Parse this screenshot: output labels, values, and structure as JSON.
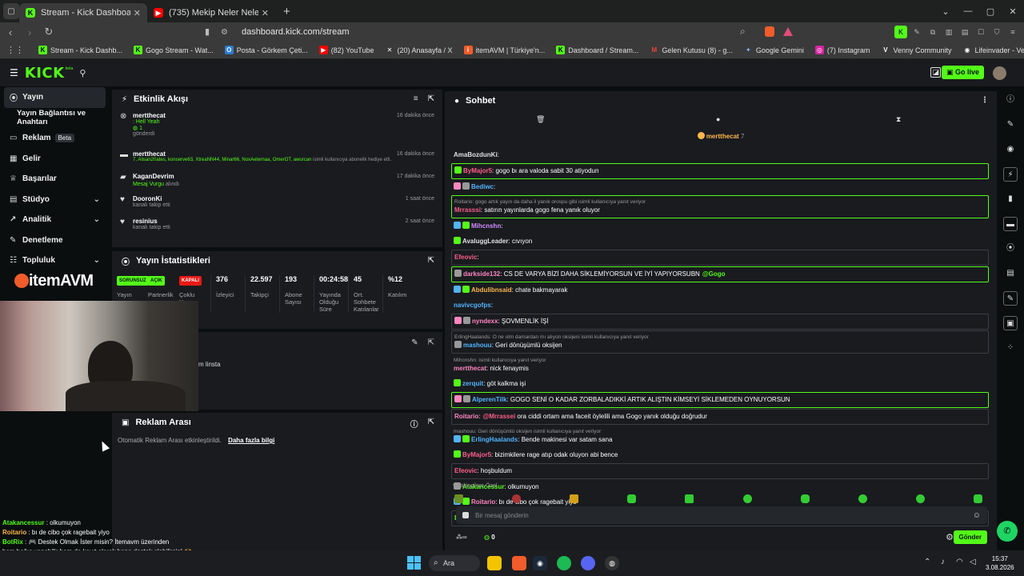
{
  "browser": {
    "tabs": [
      {
        "label": "Stream - Kick Dashboard",
        "active": true
      },
      {
        "label": "(735) Mekip Neler Neler 83.Bölüm İz"
      }
    ],
    "url": "dashboard.kick.com/stream",
    "bookmarks": [
      "Stream - Kick Dashb...",
      "Gogo Stream - Wat...",
      "Posta - Görkem Çeti...",
      "(82) YouTube",
      "(20) Anasayfa / X",
      "itemAVM | Türkiye'n...",
      "Dashboard / Stream...",
      "Gelen Kutusu (8) - g...",
      "Google Gemini",
      "(7) Instagram",
      "Venny Community",
      "Lifeinvader - VennyV"
    ]
  },
  "topnav": {
    "logo": "KICK",
    "logo_tag": "beta",
    "go_live": "Go live"
  },
  "sidebar": {
    "items": [
      {
        "label": "Yayın",
        "icon": "broadcast-icon",
        "active": true
      },
      {
        "label": "Yayın Bağlantısı ve Anahtarı"
      },
      {
        "label": "Reklam",
        "icon": "ad-icon",
        "badge": "Beta"
      },
      {
        "label": "Gelir",
        "icon": "money-icon"
      },
      {
        "label": "Başarılar",
        "icon": "trophy-icon"
      },
      {
        "label": "Stüdyo",
        "icon": "studio-icon",
        "expandable": true
      },
      {
        "label": "Analitik",
        "icon": "analytics-icon",
        "expandable": true
      },
      {
        "label": "Denetleme",
        "icon": "wrench-icon"
      },
      {
        "label": "Topluluk",
        "icon": "community-icon",
        "expandable": true
      }
    ]
  },
  "activity": {
    "title": "Etkinlik Akışı",
    "events": [
      {
        "user": "mertthecat",
        "detail": ": Hell Yeah",
        "amount": "1",
        "sub": "gönderdi",
        "time": "16 dakika önce"
      },
      {
        "user": "mertthecat",
        "detail": "7, Alisan20ates, konserve63, XtreaNN44, Minar66, NoxAeternaa, OmerOT, awurcan",
        "detail_suffix": " isimli kullanıcıya abonelik hediye etti.",
        "time": "16 dakika önce"
      },
      {
        "user": "KaganDevrim",
        "detail": "Mesaj Vurgu",
        "detail_suffix": " alındı",
        "time": "17 dakika önce"
      },
      {
        "user": "DooronKi",
        "sub": "kanalı takip etti",
        "time": "1 saat önce"
      },
      {
        "user": "resinius",
        "sub": "kanalı takip etti",
        "time": "2 saat önce"
      }
    ]
  },
  "stats": {
    "title": "Yayın İstatistikleri",
    "items": [
      {
        "value": "SORUNSUZ",
        "label": "Yayın",
        "pill": "#53fc18"
      },
      {
        "value": "AÇIK",
        "label": "Partnerlik",
        "pill": "#53fc18"
      },
      {
        "value": "KAPALI",
        "label": "Çoklu Yayın",
        "pill": "#e91916"
      },
      {
        "value": "376",
        "label": "İzleyici"
      },
      {
        "value": "22.597",
        "label": "Takipçi"
      },
      {
        "value": "193",
        "label": "Abone Sayısı"
      },
      {
        "value": "00:24:58",
        "label": "Yayında Olduğu Süre"
      },
      {
        "value": "45",
        "label": "Ort. Sohbete Katılanlar"
      },
      {
        "value": "%12",
        "label": "Katılım"
      }
    ]
  },
  "mid_panel": {
    "text": "m linsta"
  },
  "ad_break": {
    "title": "Reklam Arası",
    "text": "Otomatik Reklam Arası etkinleştirildi.",
    "link": "Daha fazla bilgi"
  },
  "chat": {
    "title": "Sohbet",
    "pinned_user": "mertthecat",
    "pinned_count": "7",
    "messages": [
      {
        "user": "AmaBozdunKi",
        "text": ":",
        "color": "#e0e0e0",
        "style": "none"
      },
      {
        "user": "ByMajor5",
        "text": ": gogo bı ara valoda sabit 30 atiyodun",
        "color": "#ff5e8a",
        "style": "hl"
      },
      {
        "user": "Bediwc",
        "text": ":",
        "color": "#53b4ff",
        "style": "none"
      },
      {
        "reply": "Roitario: gogo artık yayın da daha il yanık orospu gibi isimli kullanıcıya yanıt veriyor",
        "user": "Mrrasssi",
        "text": ": satırın yayınlarda gogo fena yanık oluyor",
        "color": "#ff5e8a",
        "style": "hl"
      },
      {
        "user": "Mihcnshn",
        "text": ":",
        "color": "#d18bff",
        "style": "none"
      },
      {
        "user": "AvaluggLeader",
        "text": ": cıvıyon",
        "color": "#e0e0e0",
        "style": "none"
      },
      {
        "user": "Efeovic",
        "text": ":",
        "color": "#ff5e8a",
        "style": "grey"
      },
      {
        "user": "darkside132",
        "text": ": CS DE VARYA BİZİ DAHA SİKLEMİYORSUN VE İYİ YAPIYORSUBN",
        "mention": "@Gogo",
        "color": "#ff86c0",
        "style": "hl"
      },
      {
        "user": "Abdulibnsaid",
        "text": ": chate bakmayarak",
        "color": "#ffb74d",
        "style": "none"
      },
      {
        "user": "navivcgofps",
        "text": ":",
        "color": "#53b4ff",
        "style": "none"
      },
      {
        "user": "nyndexx",
        "text": ": ŞOVMENLİK İŞİ",
        "color": "#ff86c0",
        "style": "grey"
      },
      {
        "reply": "ErlingHaalands: O ne olm damardan mı alıyon oksijeni isimli kullanıcıya yanıt veriyor",
        "user": "mashouu",
        "text": ": Geri dönüşümlü oksijen",
        "color": "#53b4ff",
        "style": "grey"
      },
      {
        "reply": "Mihcnshn: isimli kullanıcıya yanıt veriyor",
        "user": "mertthecat",
        "text": ": nick fenaymis",
        "color": "#ff86c0",
        "style": "none"
      },
      {
        "user": "zerquit",
        "text": ": göt kalkma işi",
        "color": "#53b4ff",
        "style": "none"
      },
      {
        "user": "AlperenTilk",
        "text": ": GOGO SENİ O KADAR ZORBALADIKKİ ARTIK ALIŞTIN KİMSEYİ SİKLEMEDEN OYNUYORSUN",
        "color": "#53b4ff",
        "style": "hl"
      },
      {
        "user": "Roitario",
        "text": ":",
        "mention": "@Mrrassei",
        "text2": " ora ciddi ortam ama faceit öylelili ama Gogo yanık olduğu doğrudur",
        "color": "#ff86c0",
        "style": "grey"
      },
      {
        "reply": "mashouu: Geri dönüşümlü oksijen isimli kullanıcıya yanıt veriyor",
        "user": "ErlingHaalands",
        "text": ": Bende makinesi var satam sana",
        "color": "#53b4ff",
        "style": "none"
      },
      {
        "user": "ByMajor5",
        "text": ": bizimkilere rage atıp odak oluyon abi bence",
        "color": "#ff5e8a",
        "style": "none"
      },
      {
        "user": "Efeovic",
        "text": ": hoşbuldum",
        "color": "#ff5e8a",
        "style": "grey"
      },
      {
        "user": "Atakancessur",
        "text": ": olkumuyon",
        "color": "#53fc18",
        "style": "none"
      },
      {
        "user": "Roitario",
        "text": ": bı de cibo çok ragebait yiyo",
        "color": "#ff86c0",
        "style": "none"
      },
      {
        "user": "BotRix",
        "text": ": 🎮 Destek Olmak İster misin? İtemavm üzerinden hem bağış yapabilir hem de kayıt olarak bana destek olabilirsin! 🙌 👉",
        "link": "https://itemavm.com/ref/gxmueu1",
        "color": "#53fc18",
        "style": "grey"
      }
    ],
    "followers_label": "Takipçilere Özel",
    "input_placeholder": "Bir mesaj gönderin",
    "send_label": "Gönder",
    "points": "0"
  },
  "overlay": {
    "lines": [
      {
        "user": "Atakancessur",
        "text": " : olkumuyon",
        "color": "#53fc18"
      },
      {
        "user": "Roitario",
        "text": " : bı de cibo çok ragebait yiyo",
        "color": "#ffb74d"
      },
      {
        "user": "BotRix",
        "text": " : 🎮 Destek Olmak İster misin? İtemavm üzerinden",
        "color": "#53fc18"
      },
      {
        "user": "",
        "text": "hem bağış yapabilir hem de kayıt olarak bana destek olabilirsin! 🙌",
        "color": "#fff"
      },
      {
        "user": "",
        "text": "https://itemavm.com/ref/gxmueu1",
        "color": "#8ab4ff"
      }
    ],
    "brand": "itemAVM"
  },
  "taskbar": {
    "search": "Ara",
    "time": "15:37",
    "date": "3.08.2026"
  }
}
